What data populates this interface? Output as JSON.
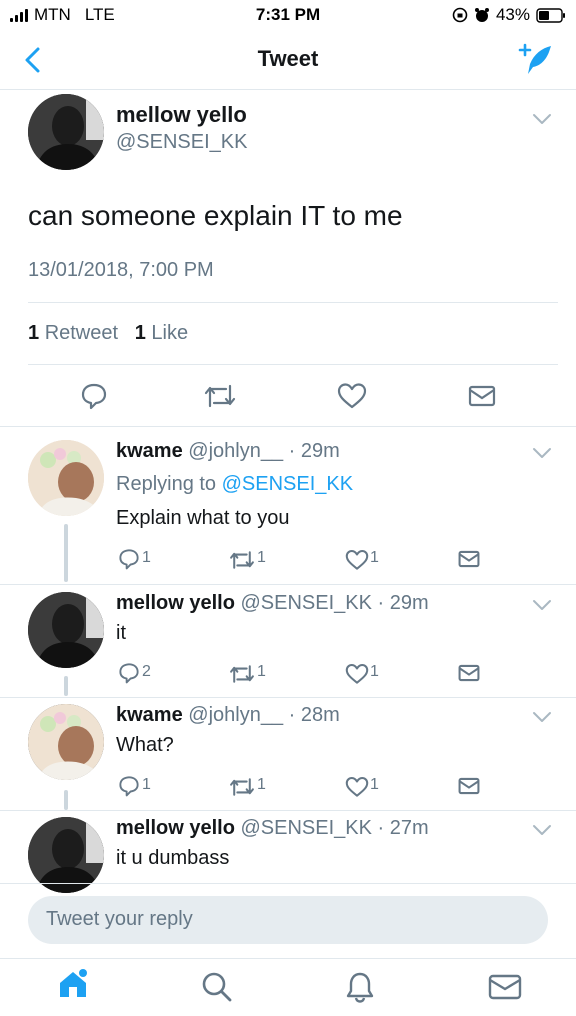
{
  "status_bar": {
    "carrier": "MTN",
    "network": "LTE",
    "time": "7:31 PM",
    "battery": "43%"
  },
  "nav": {
    "title": "Tweet",
    "back_icon": "chevron-left-icon",
    "compose_icon": "compose-tweet-icon"
  },
  "main_tweet": {
    "name": "mellow yello",
    "handle": "@SENSEI_KK",
    "text": "can someone explain IT to me",
    "timestamp": "13/01/2018, 7:00 PM",
    "retweets": "1",
    "retweets_label": "Retweet",
    "likes": "1",
    "likes_label": "Like"
  },
  "replies": [
    {
      "name": "kwame",
      "handle": "@johlyn__",
      "time": "· 29m",
      "replying_prefix": "Replying to",
      "replying_to": "@SENSEI_KK",
      "text": "Explain what to you",
      "reply_count": "1",
      "retweet_count": "1",
      "like_count": "1"
    },
    {
      "name": "mellow yello",
      "handle": "@SENSEI_KK",
      "time": "· 29m",
      "text": "it",
      "reply_count": "2",
      "retweet_count": "1",
      "like_count": "1"
    },
    {
      "name": "kwame",
      "handle": "@johlyn__",
      "time": "· 28m",
      "text": "What?",
      "reply_count": "1",
      "retweet_count": "1",
      "like_count": "1"
    },
    {
      "name": "mellow yello",
      "handle": "@SENSEI_KK",
      "time": "· 27m",
      "text": "it u dumbass"
    }
  ],
  "reply_box": {
    "placeholder": "Tweet your reply"
  },
  "tab_bar": {
    "items": [
      "home-icon",
      "search-icon",
      "notifications-icon",
      "messages-icon"
    ]
  },
  "colors": {
    "accent": "#1da1f2",
    "text": "#14171a",
    "secondary": "#657786",
    "divider": "#e1e8ed"
  }
}
